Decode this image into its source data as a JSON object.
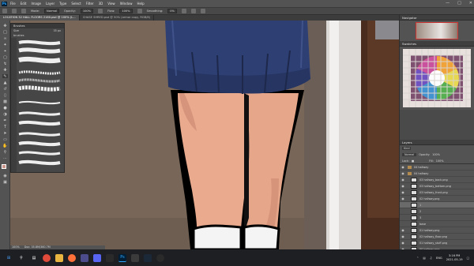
{
  "menubar": {
    "app_icon": "Ps",
    "items": [
      "File",
      "Edit",
      "Image",
      "Layer",
      "Type",
      "Select",
      "Filter",
      "3D",
      "View",
      "Window",
      "Help"
    ]
  },
  "optionsbar": {
    "mode_label": "Mode:",
    "mode_value": "Normal",
    "opacity_label": "Opacity:",
    "opacity_value": "100%",
    "flow_label": "Flow:",
    "flow_value": "100%",
    "smoothing_label": "Smoothing:",
    "smoothing_value": "0%"
  },
  "tabs": [
    {
      "label": "LOCATION 32 HALL FLOORS 2160.psd @ 100% (L...",
      "active": true
    },
    {
      "label": "CHASE SHRED.psd @ 50% (armor copy, RGB/8)",
      "active": false
    }
  ],
  "brushes_panel": {
    "title": "Brushes",
    "size_label": "Size",
    "size_value": "35 px",
    "group_label": "brushes"
  },
  "right_panels": {
    "navigator_title": "Navigator",
    "swatches_title": "Swatches",
    "layers_title": "Layers",
    "kind_label": "Kind",
    "blend_mode": "Normal",
    "opacity_label": "Opacity:",
    "opacity_value": "100%",
    "lock_label": "Lock:",
    "fill_label": "Fill:",
    "fill_value": "100%"
  },
  "layers": [
    {
      "name": "04 hallway",
      "type": "folder",
      "visible": true
    },
    {
      "name": "04 hallway",
      "type": "folder",
      "visible": true
    },
    {
      "name": "03 hallway_back.png",
      "type": "layer",
      "visible": true
    },
    {
      "name": "03 hallway_bottom.png",
      "type": "layer",
      "visible": true
    },
    {
      "name": "03 hallway_front.png",
      "type": "layer",
      "visible": true
    },
    {
      "name": "02 hallway.png",
      "type": "layer",
      "visible": true
    },
    {
      "name": "1",
      "type": "layer",
      "visible": false,
      "selected": true
    },
    {
      "name": "2",
      "type": "layer",
      "visible": false
    },
    {
      "name": "3",
      "type": "layer",
      "visible": false
    },
    {
      "name": "base",
      "type": "layer",
      "visible": false
    },
    {
      "name": "01 hallway.png",
      "type": "layer",
      "visible": true
    },
    {
      "name": "02 hallway_floor.png",
      "type": "layer",
      "visible": true
    },
    {
      "name": "01 hallway_stuff.png",
      "type": "layer",
      "visible": true
    },
    {
      "name": "00 hallway.png",
      "type": "layer",
      "visible": true
    }
  ],
  "statusbar": {
    "zoom": "100%",
    "doc_info": "Doc: 35.8M/360.7M"
  },
  "taskbar": {
    "time": "3:16 PM",
    "date": "2021-05-19",
    "lang": "ENG"
  },
  "colors": {
    "accent": "#31a8ff",
    "skirt": "#2e3f73",
    "skin": "#e8a88c",
    "wall": "#786658"
  }
}
